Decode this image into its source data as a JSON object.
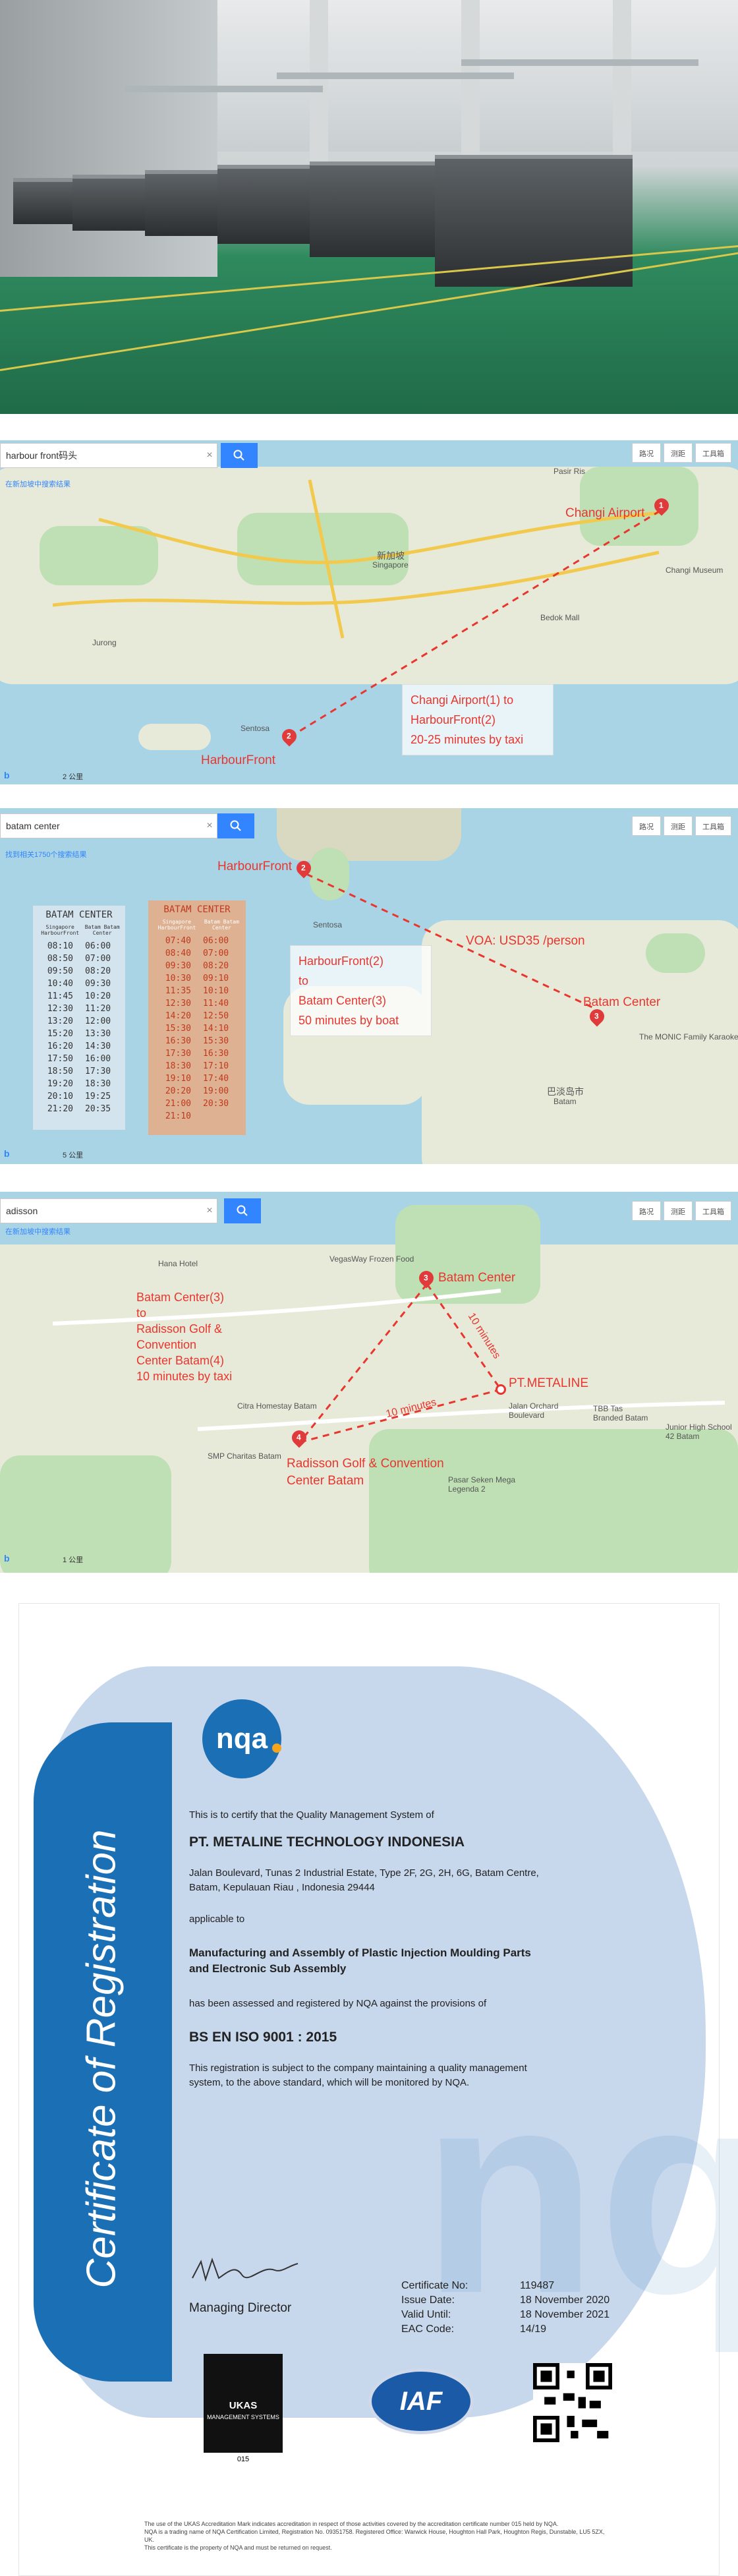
{
  "map1": {
    "search_value": "harbour front码头",
    "hint": "在新加坡中搜索结果",
    "toolbar": [
      "路况",
      "测距",
      "工具箱"
    ],
    "places": [
      {
        "name": "Changi Airport"
      },
      {
        "name": "HarbourFront"
      },
      {
        "name": "新加坡"
      },
      {
        "name": "Singapore"
      },
      {
        "name": "Sentosa"
      },
      {
        "name": "Jurong"
      },
      {
        "name": "Changi Museum"
      },
      {
        "name": "Pasir Ris"
      },
      {
        "name": "Bedok Mall"
      }
    ],
    "info_lines": [
      "Changi Airport(1)  to",
      "HarbourFront(2)",
      "20-25 minutes by taxi"
    ],
    "pins": [
      "1",
      "2"
    ],
    "scale": "2 公里"
  },
  "map2": {
    "search_value": "batam center",
    "hint": "找到相关1750个搜索结果",
    "toolbar": [
      "路况",
      "测距",
      "工具箱"
    ],
    "harbourfront": "HarbourFront",
    "batam_center": "Batam Center",
    "voa": "VOA: USD35 /person",
    "info_lines": [
      "HarbourFront(2)",
      "to",
      "Batam Center(3)",
      "50 minutes by boat"
    ],
    "places": [
      {
        "name": "巴淡岛市"
      },
      {
        "name": "Batam"
      },
      {
        "name": "Sentosa"
      },
      {
        "name": "The MONIC Family Karaoke"
      }
    ],
    "timetable_left": {
      "title": "BATAM CENTER",
      "headers": [
        "Singapore HarbourFront",
        "Batam Batam Center"
      ],
      "left": [
        "08:10",
        "08:50",
        "09:50",
        "10:40",
        "11:45",
        "12:30",
        "13:20",
        "15:20",
        "16:20",
        "17:50",
        "18:50",
        "19:20",
        "20:10",
        "21:20"
      ],
      "right": [
        "06:00",
        "07:00",
        "08:20",
        "09:30",
        "10:20",
        "11:20",
        "12:00",
        "13:30",
        "14:30",
        "16:00",
        "17:30",
        "18:30",
        "19:25",
        "20:35"
      ]
    },
    "timetable_right": {
      "title": "BATAM CENTER",
      "headers": [
        "Singapore HarbourFront",
        "Batam Batam Center"
      ],
      "left": [
        "07:40",
        "08:40",
        "09:30",
        "10:30",
        "11:35",
        "12:30",
        "14:20",
        "15:30",
        "16:30",
        "17:30",
        "18:30",
        "19:10",
        "20:20",
        "21:00",
        "21:10"
      ],
      "right": [
        "06:00",
        "07:00",
        "08:20",
        "09:10",
        "10:10",
        "11:40",
        "12:50",
        "14:10",
        "15:30",
        "16:30",
        "17:10",
        "17:40",
        "19:00",
        "20:30"
      ]
    },
    "pins": [
      "2",
      "3"
    ],
    "scale": "5 公里"
  },
  "map3": {
    "search_value": "adisson",
    "hint": "在新加坡中搜索结果",
    "toolbar": [
      "路况",
      "测距",
      "工具箱"
    ],
    "batam_center": "Batam Center",
    "metaline": "PT.METALINE",
    "radisson": "Radisson Golf & Convention Center Batam",
    "ten_min_a": "10 minutes",
    "ten_min_b": "10 minutes",
    "info_lines": [
      "Batam Center(3)",
      "to",
      "Radisson Golf & Convention",
      "Center Batam(4)",
      "10 minutes by taxi"
    ],
    "places": [
      {
        "name": "Hana Hotel"
      },
      {
        "name": "VegasWay Frozen Food"
      },
      {
        "name": "Jalan Orchard Boulevard"
      },
      {
        "name": "SMP Charitas Batam"
      },
      {
        "name": "Citra Homestay Batam"
      },
      {
        "name": "Junior High School 42 Batam"
      },
      {
        "name": "TBB Tas Branded Batam"
      },
      {
        "name": "Pasar Seken Mega Legenda 2"
      }
    ],
    "pins": [
      "3",
      "4"
    ],
    "scale": "1 公里"
  },
  "certificate": {
    "vertical_title": "Certificate of Registration",
    "logo": "nqa",
    "certify_text": "This is to certify that the Quality Management System of",
    "company": "PT. METALINE TECHNOLOGY INDONESIA",
    "address_1": "Jalan Boulevard, Tunas 2 Industrial Estate, Type 2F, 2G, 2H, 6G, Batam Centre,",
    "address_2": "Batam, Kepulauan Riau , Indonesia 29444",
    "applicable": "applicable to",
    "scope_1": "Manufacturing and Assembly of Plastic Injection Moulding Parts",
    "scope_2": "and Electronic Sub Assembly",
    "assessed": "has been assessed and registered by NQA against the provisions of",
    "standard": "BS EN ISO 9001 : 2015",
    "subject_1": "This registration is subject to the company maintaining a quality management",
    "subject_2": "system, to the above standard, which will be monitored by NQA.",
    "signatory": "Managing Director",
    "fields": [
      {
        "key": "Certificate No:",
        "value": "119487"
      },
      {
        "key": "Issue Date:",
        "value": "18 November 2020"
      },
      {
        "key": "Valid Until:",
        "value": "18 November 2021"
      },
      {
        "key": "EAC Code:",
        "value": "14/19"
      }
    ],
    "ukas": "UKAS",
    "ukas_sub": "MANAGEMENT SYSTEMS",
    "ukas_number": "015",
    "iaf": "IAF",
    "fine_print_1": "The use of the UKAS Accreditation Mark indicates accreditation in respect of those activities covered by the accreditation certificate number 015 held by NQA.",
    "fine_print_2": "NQA is a trading name of NQA Certification Limited, Registration No. 09351758. Registered Office: Warwick House, Houghton Hall Park, Houghton Regis, Dunstable, LU5 5ZX, UK.",
    "fine_print_3": "This certificate is the property of NQA and must be returned on request."
  }
}
